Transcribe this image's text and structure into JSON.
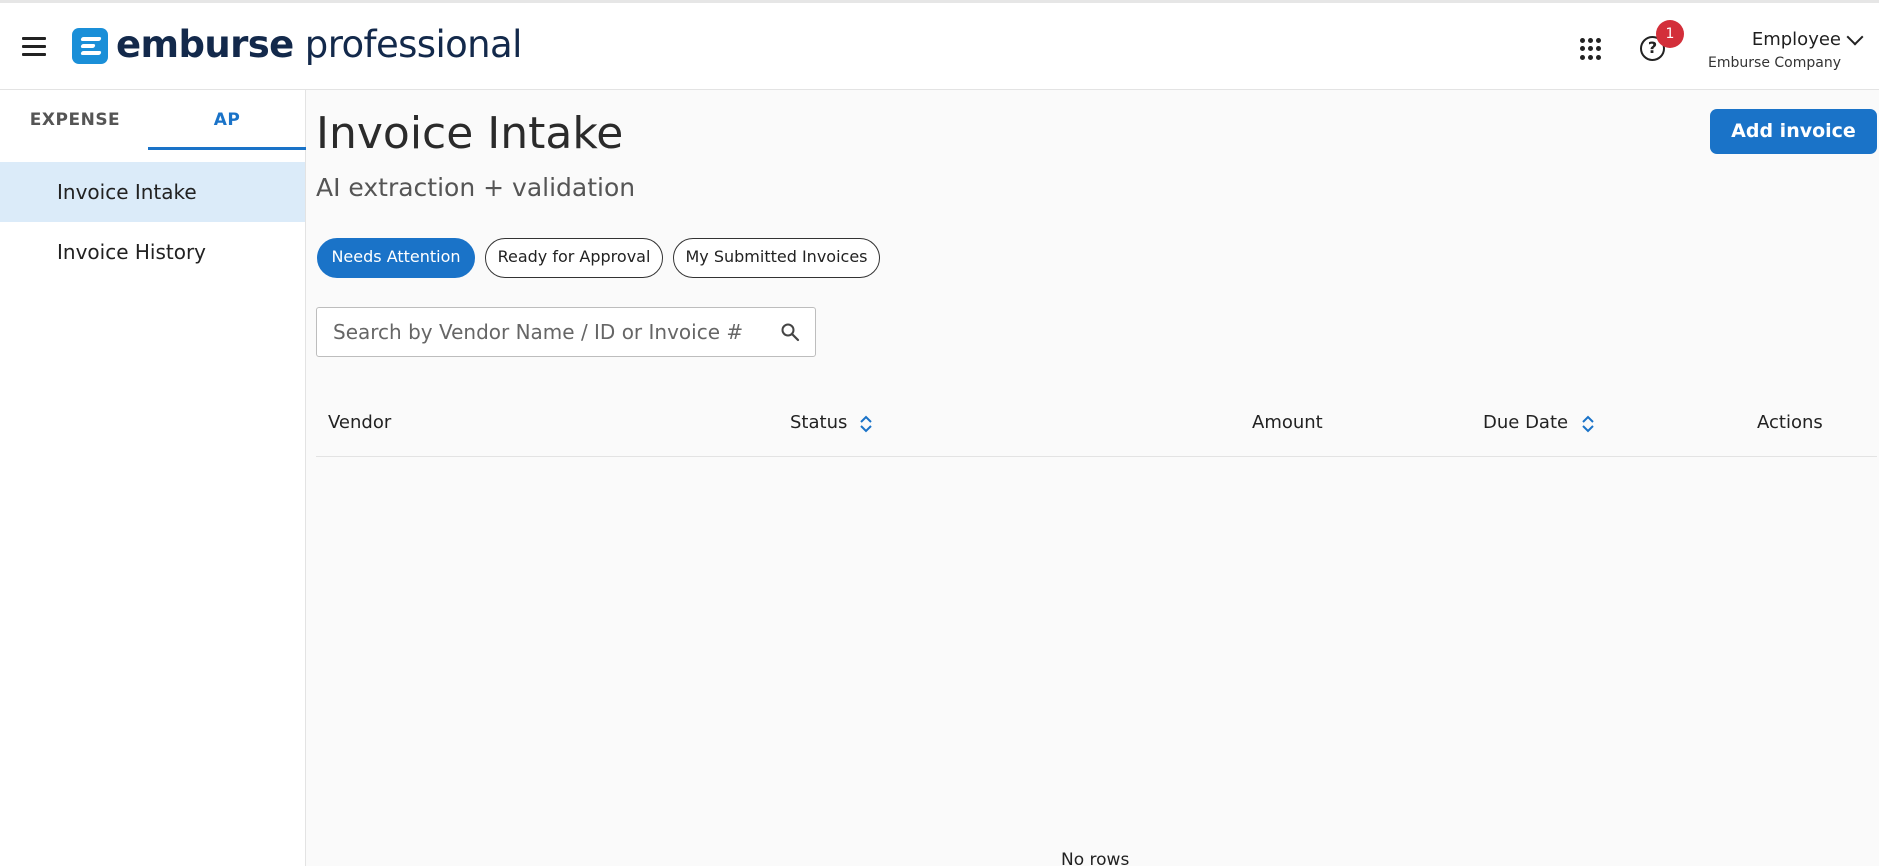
{
  "header": {
    "logo_bold": "emburse",
    "logo_light": " professional",
    "notification_count": "1",
    "user_name": "Employee",
    "company": "Emburse Company"
  },
  "sidebar": {
    "tabs": [
      {
        "label": "EXPENSE"
      },
      {
        "label": "AP"
      }
    ],
    "items": [
      {
        "label": "Invoice Intake"
      },
      {
        "label": "Invoice History"
      }
    ]
  },
  "main": {
    "title": "Invoice Intake",
    "subtitle": "AI extraction + validation",
    "add_button": "Add invoice",
    "filters": [
      {
        "label": "Needs Attention"
      },
      {
        "label": "Ready for Approval"
      },
      {
        "label": "My Submitted Invoices"
      }
    ],
    "search": {
      "placeholder": "Search by Vendor Name / ID or Invoice #",
      "value": ""
    },
    "table": {
      "columns": [
        "Vendor",
        "Status",
        "Amount",
        "Due Date",
        "Actions"
      ],
      "empty_text": "No rows"
    }
  },
  "colors": {
    "accent": "#1a73c8",
    "active_nav_bg": "#dbebf9",
    "badge": "#d32f3a",
    "logo_mark": "#1a8fd8",
    "logo_text": "#13294b"
  },
  "icons": [
    "hamburger-menu-icon",
    "logo-mark-icon",
    "apps-grid-icon",
    "help-icon",
    "chevron-down-icon",
    "search-icon",
    "sort-icon"
  ]
}
